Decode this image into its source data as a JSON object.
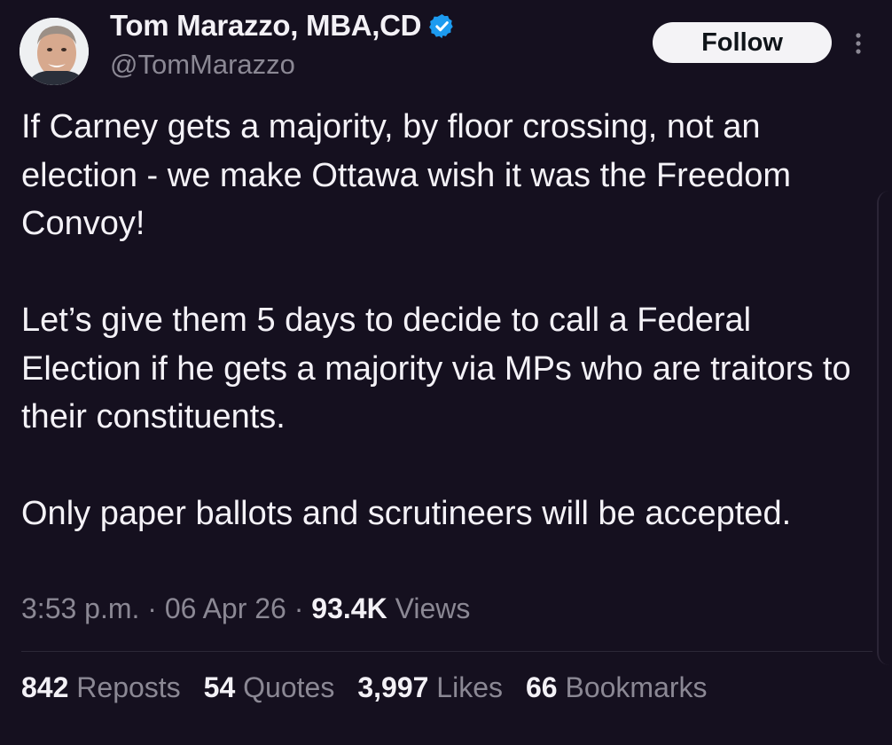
{
  "tweet": {
    "author": {
      "display_name": "Tom Marazzo, MBA,CD",
      "handle": "@TomMarazzo",
      "verified": true,
      "verified_color": "#1d9bf0"
    },
    "follow_label": "Follow",
    "paragraphs": [
      "If Carney gets a majority, by floor crossing, not an election - we make Ottawa wish it was the Freedom Convoy!",
      "Let’s give them 5 days to decide to call a Federal Election if he gets a majority via MPs who are traitors to their constituents.",
      "Only paper ballots and scrutineers will be accepted."
    ],
    "time": "3:53 p.m.",
    "date": "06 Apr 26",
    "separator": "·",
    "views_count": "93.4K",
    "views_label": "Views",
    "stats": {
      "reposts_count": "842",
      "reposts_label": "Reposts",
      "quotes_count": "54",
      "quotes_label": "Quotes",
      "likes_count": "3,997",
      "likes_label": "Likes",
      "bookmarks_count": "66",
      "bookmarks_label": "Bookmarks"
    }
  },
  "icons": {
    "verified": "verified-badge-icon",
    "more": "more-options-icon"
  },
  "colors": {
    "background": "#15101f",
    "text": "#f4f2f7",
    "secondary_text": "#8b8894",
    "follow_button_bg": "#f4f3f6"
  }
}
